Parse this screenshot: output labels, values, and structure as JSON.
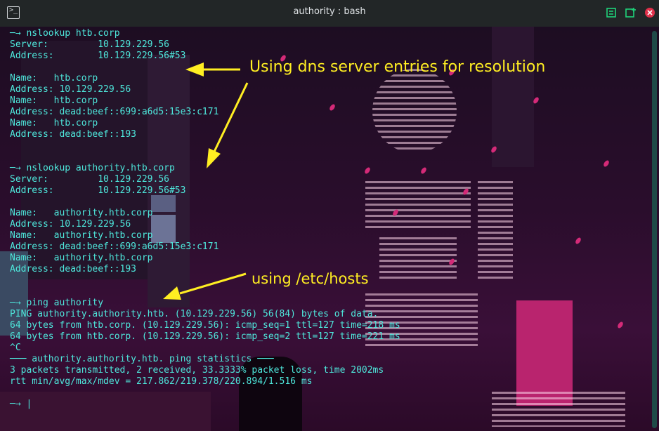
{
  "window": {
    "title": "authority : bash",
    "app_icon": "terminal-icon",
    "buttons": [
      {
        "name": "maximize",
        "icon": "maximize-icon",
        "color": "#1fd27a"
      },
      {
        "name": "new-tab",
        "icon": "new-tab-icon",
        "color": "#1fd27a"
      },
      {
        "name": "close",
        "icon": "close-icon",
        "color": "#e0304a"
      }
    ]
  },
  "terminal": {
    "text_color": "#4ee8dc",
    "lines": [
      "─→ nslookup htb.corp",
      "Server:         10.129.229.56",
      "Address:        10.129.229.56#53",
      "",
      "Name:   htb.corp",
      "Address: 10.129.229.56",
      "Name:   htb.corp",
      "Address: dead:beef::699:a6d5:15e3:c171",
      "Name:   htb.corp",
      "Address: dead:beef::193",
      "",
      "",
      "─→ nslookup authority.htb.corp",
      "Server:         10.129.229.56",
      "Address:        10.129.229.56#53",
      "",
      "Name:   authority.htb.corp",
      "Address: 10.129.229.56",
      "Name:   authority.htb.corp",
      "Address: dead:beef::699:a6d5:15e3:c171",
      "Name:   authority.htb.corp",
      "Address: dead:beef::193",
      "",
      "",
      "─→ ping authority",
      "PING authority.authority.htb. (10.129.229.56) 56(84) bytes of data.",
      "64 bytes from htb.corp. (10.129.229.56): icmp_seq=1 ttl=127 time=218 ms",
      "64 bytes from htb.corp. (10.129.229.56): icmp_seq=2 ttl=127 time=221 ms",
      "^C",
      "─── authority.authority.htb. ping statistics ───",
      "3 packets transmitted, 2 received, 33.3333% packet loss, time 2002ms",
      "rtt min/avg/max/mdev = 217.862/219.378/220.894/1.516 ms",
      ""
    ],
    "prompt": "─→ ",
    "cursor": "|"
  },
  "annotations": {
    "dns_note": "Using dns server entries for resolution",
    "hosts_note": "using /etc/hosts",
    "color": "#ffee22"
  }
}
